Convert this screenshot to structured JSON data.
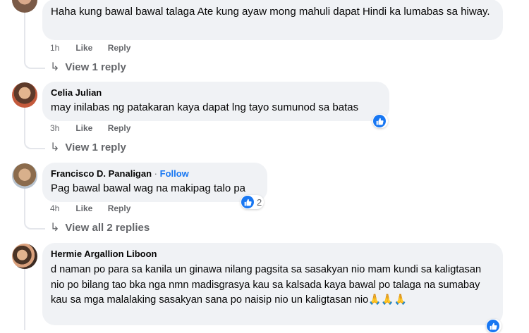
{
  "comments": [
    {
      "text": "Haha kung bawal bawal talaga Ate kung ayaw mong mahuli dapat Hindi ka lumabas sa hiway.",
      "time": "1h",
      "like": "Like",
      "reply": "Reply",
      "view_replies": "View 1 reply"
    },
    {
      "author": "Celia Julian",
      "text": "may inilabas ng patakaran kaya dapat lng tayo sumunod sa batas",
      "time": "3h",
      "like": "Like",
      "reply": "Reply",
      "view_replies": "View 1 reply",
      "reaction_icon": "like-icon"
    },
    {
      "author": "Francisco D. Panaligan",
      "separator": "·",
      "follow": "Follow",
      "text": "Pag bawal bawal wag na makipag talo pa",
      "time": "4h",
      "like": "Like",
      "reply": "Reply",
      "view_replies": "View all 2 replies",
      "reaction_icon": "like-icon",
      "reaction_count": "2"
    },
    {
      "author": "Hermie Argallion Liboon",
      "text": "d naman po para sa kanila un ginawa nilang pagsita sa sasakyan nio mam kundi sa kaligtasan nio po bilang tao bka nga nmn madisgrasya kau sa kalsada kaya bawal po talaga na sumabay kau sa mga malalaking sasakyan sana po naisip nio un kaligtasan nio🙏🙏🙏",
      "reaction_icon": "like-icon"
    }
  ],
  "colors": {
    "accent": "#1877f2",
    "bubble": "#f0f2f5",
    "muted": "#65676b"
  },
  "icons": {
    "reply_arrow": "reply-arrow-icon"
  }
}
